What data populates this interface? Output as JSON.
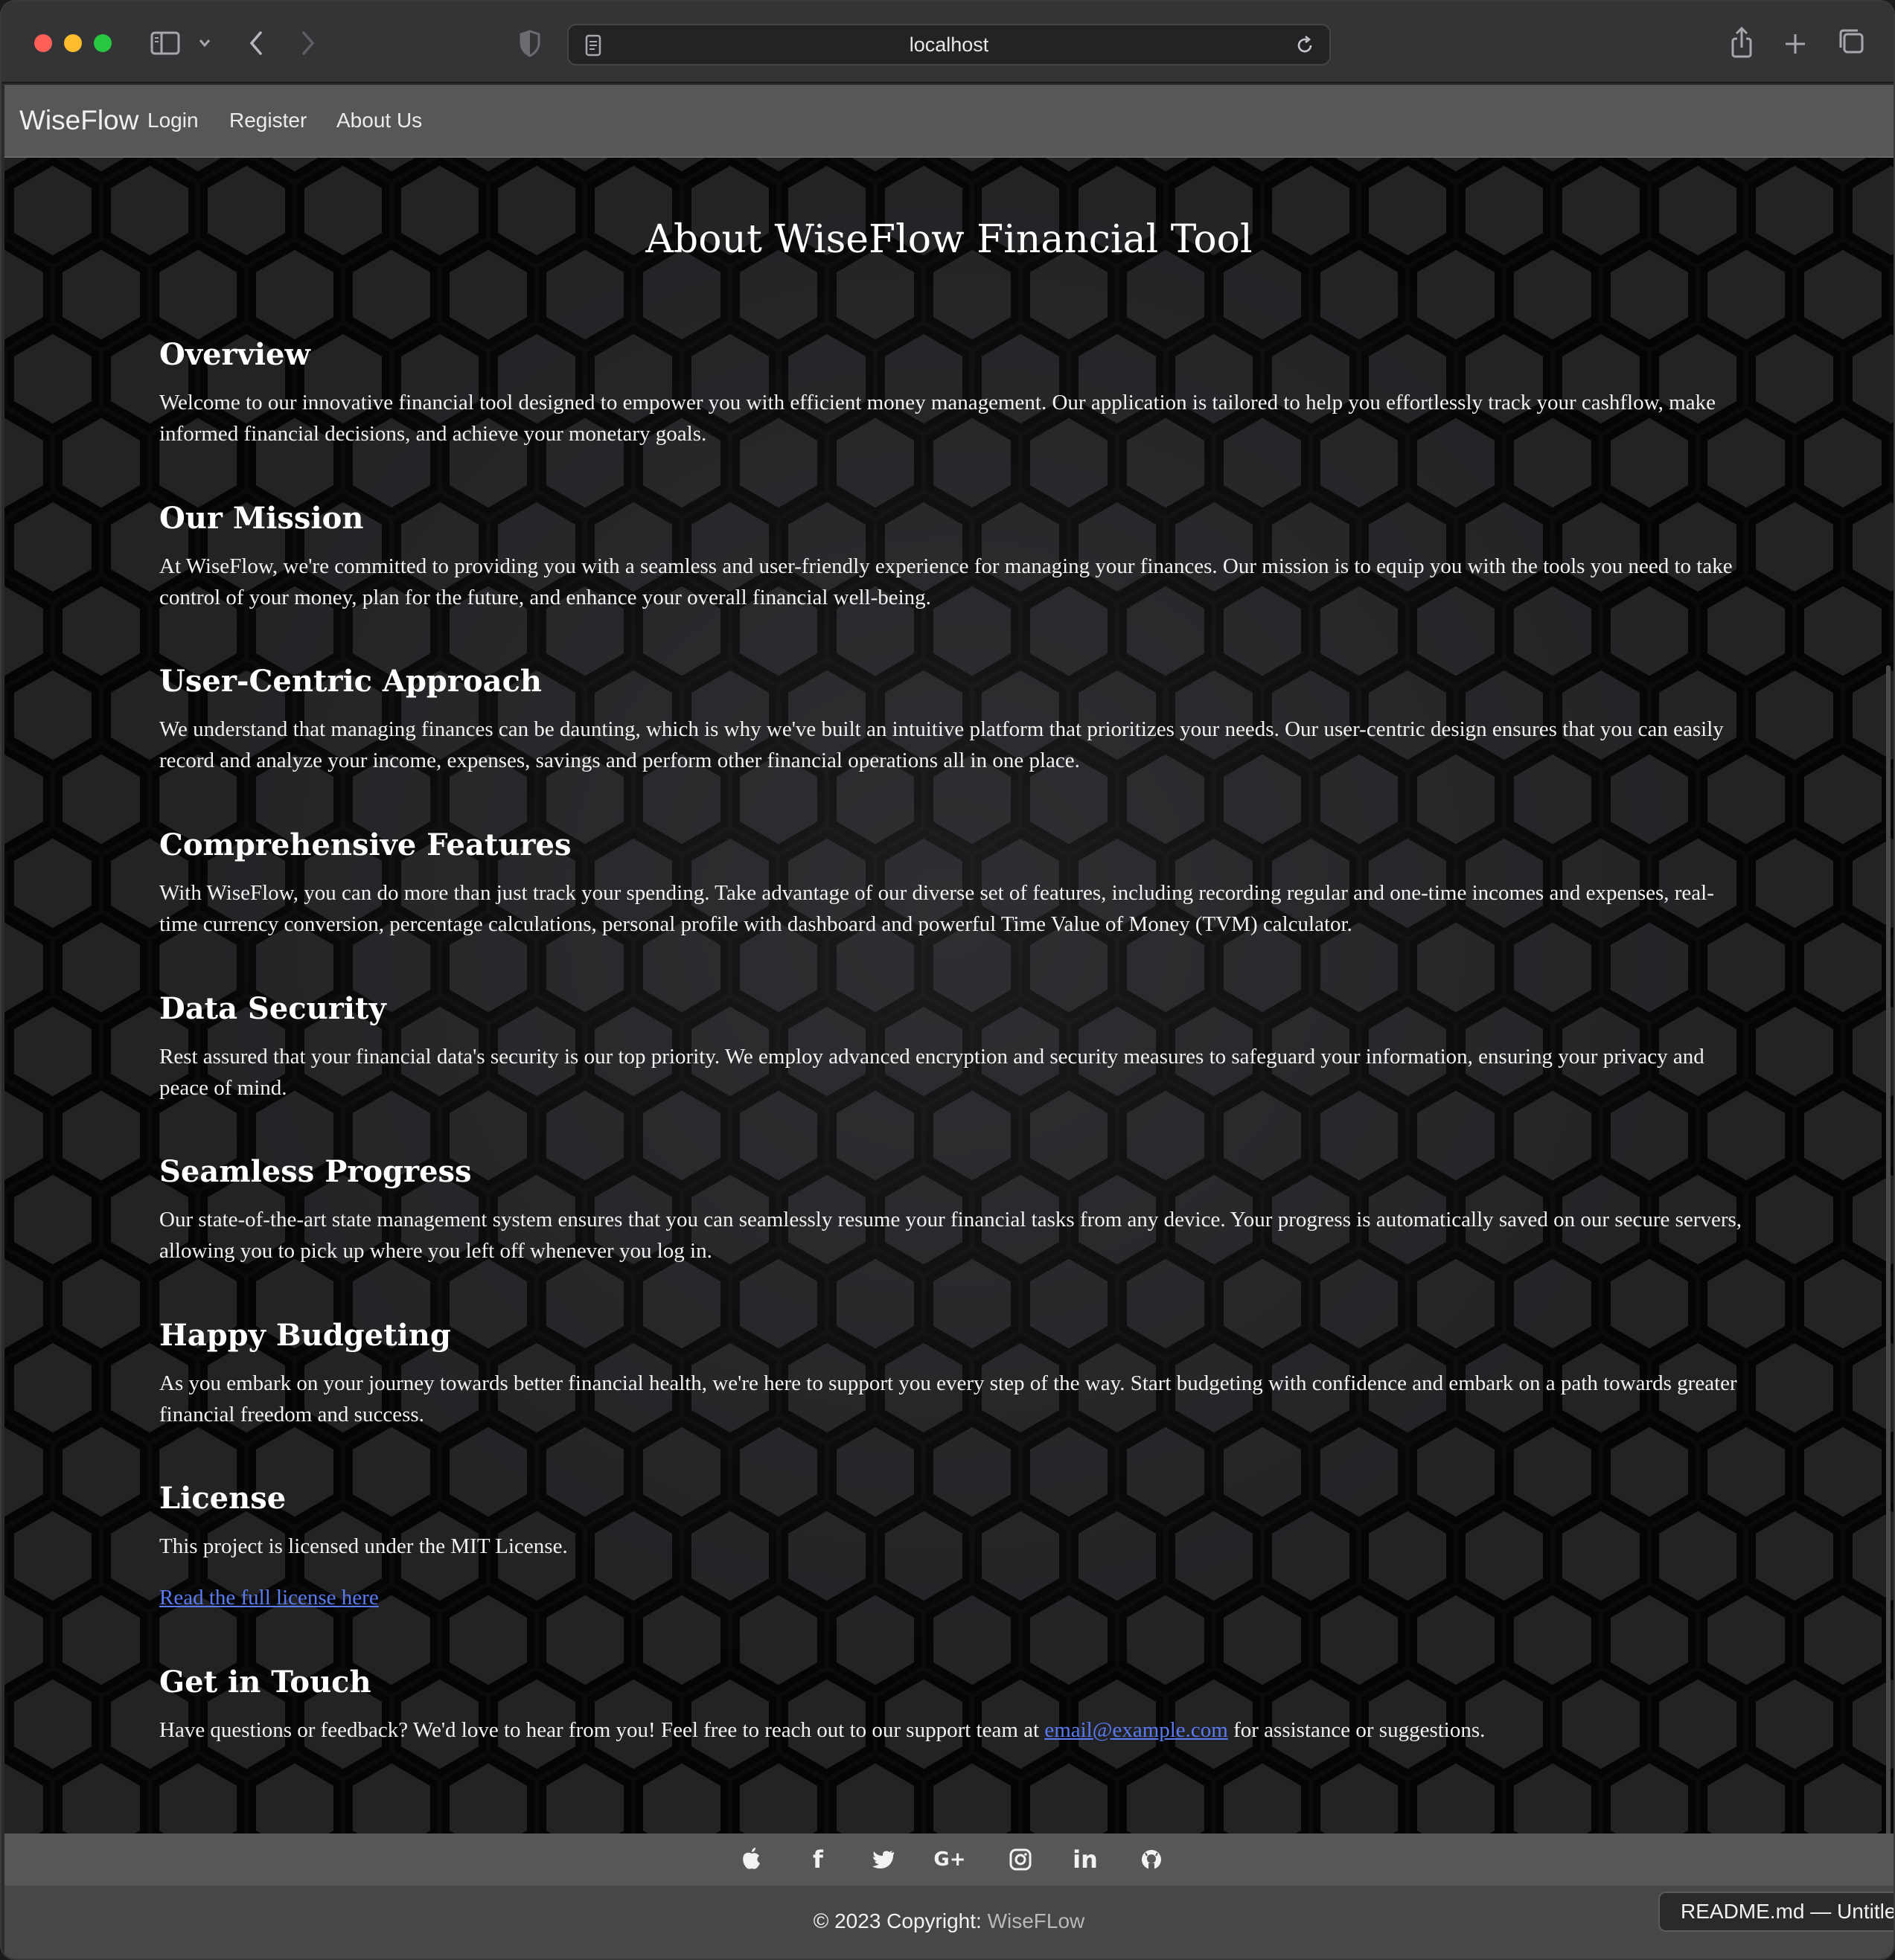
{
  "browser": {
    "url": "localhost"
  },
  "navbar": {
    "brand": "WiseFlow",
    "links": [
      "Login",
      "Register",
      "About Us"
    ]
  },
  "page": {
    "title": "About WiseFlow Financial Tool",
    "sections": [
      {
        "heading": "Overview",
        "body": "Welcome to our innovative financial tool designed to empower you with efficient money management. Our application is tailored to help you effortlessly track your cashflow, make informed financial decisions, and achieve your monetary goals."
      },
      {
        "heading": "Our Mission",
        "body": "At WiseFlow, we're committed to providing you with a seamless and user-friendly experience for managing your finances. Our mission is to equip you with the tools you need to take control of your money, plan for the future, and enhance your overall financial well-being."
      },
      {
        "heading": "User-Centric Approach",
        "body": "We understand that managing finances can be daunting, which is why we've built an intuitive platform that prioritizes your needs. Our user-centric design ensures that you can easily record and analyze your income, expenses, savings and perform other financial operations all in one place."
      },
      {
        "heading": "Comprehensive Features",
        "body": "With WiseFlow, you can do more than just track your spending. Take advantage of our diverse set of features, including recording regular and one-time incomes and expenses, real-time currency conversion, percentage calculations, personal profile with dashboard and powerful Time Value of Money (TVM) calculator."
      },
      {
        "heading": "Data Security",
        "body": "Rest assured that your financial data's security is our top priority. We employ advanced encryption and security measures to safeguard your information, ensuring your privacy and peace of mind."
      },
      {
        "heading": "Seamless Progress",
        "body": "Our state-of-the-art state management system ensures that you can seamlessly resume your financial tasks from any device. Your progress is automatically saved on our secure servers, allowing you to pick up where you left off whenever you log in."
      },
      {
        "heading": "Happy Budgeting",
        "body": "As you embark on your journey towards better financial health, we're here to support you every step of the way. Start budgeting with confidence and embark on a path towards greater financial freedom and success."
      }
    ],
    "license": {
      "heading": "License",
      "body": "This project is licensed under the MIT License.",
      "link": "Read the full license here"
    },
    "contact": {
      "heading": "Get in Touch",
      "body_before": "Have questions or feedback? We'd love to hear from you! Feel free to reach out to our support team at ",
      "email": "email@example.com",
      "body_after": " for assistance or suggestions."
    }
  },
  "footer": {
    "social_icons": [
      {
        "name": "apple-icon",
        "glyph": ""
      },
      {
        "name": "facebook-icon",
        "glyph": "f"
      },
      {
        "name": "twitter-icon",
        "glyph": ""
      },
      {
        "name": "google-plus-icon",
        "glyph": "G+"
      },
      {
        "name": "instagram-icon",
        "glyph": ""
      },
      {
        "name": "linkedin-icon",
        "glyph": "in"
      },
      {
        "name": "github-icon",
        "glyph": ""
      }
    ],
    "copyright": "© 2023 Copyright: ",
    "brand": "WiseFLow"
  },
  "tooltip": {
    "text": "README.md — Untitled"
  },
  "colors": {
    "navbar_bg": "#575757",
    "link": "#5a7bf2",
    "footer_bg": "#474747"
  }
}
